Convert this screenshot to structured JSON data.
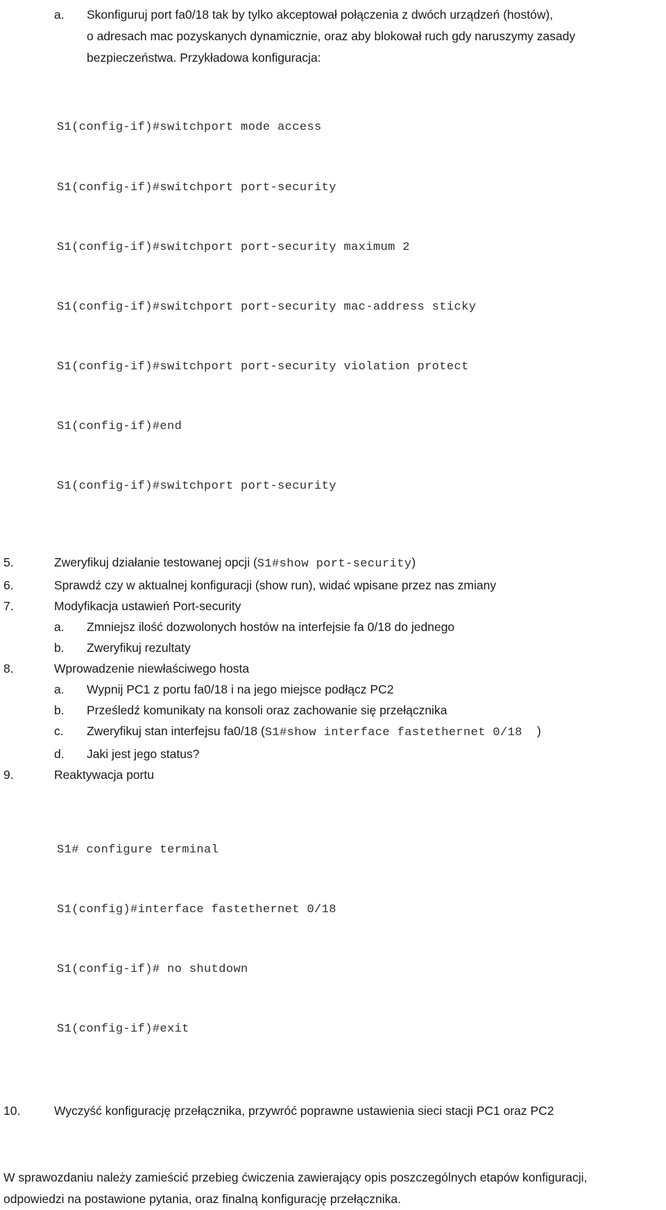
{
  "document": {
    "language": "pl",
    "colors": {
      "background": "#ffffff",
      "body_text": "#1a1a1a",
      "code_text": "#2e2e2e"
    },
    "item_a": {
      "marker": "a.",
      "line1": "Skonfiguruj port fa0/18 tak by tylko akceptował połączenia z dwóch urządzeń (hostów),",
      "line2": "o adresach mac pozyskanych dynamicznie, oraz aby blokował ruch gdy naruszymy zasady",
      "line3": "bezpieczeństwa. Przykładowa konfiguracja:"
    },
    "code_block_1": {
      "lines": [
        "S1(config-if)#switchport mode access",
        "S1(config-if)#switchport port-security",
        "S1(config-if)#switchport port-security maximum 2",
        "S1(config-if)#switchport port-security mac-address sticky",
        "S1(config-if)#switchport port-security violation protect",
        "S1(config-if)#end",
        "S1(config-if)#switchport port-security"
      ]
    },
    "steps": [
      {
        "marker": "5.",
        "text_before": "Zweryfikuj działanie testowanej opcji (",
        "code": "S1#show port-security",
        "text_after": ")"
      },
      {
        "marker": "6.",
        "text_before": "Sprawdź czy w aktualnej konfiguracji (show run), widać wpisane przez nas zmiany",
        "code": "",
        "text_after": ""
      },
      {
        "marker": "7.",
        "text_before": "Modyfikacja ustawień Port-security",
        "code": "",
        "text_after": ""
      }
    ],
    "step7_sub": [
      {
        "marker": "a.",
        "text_before": "Zmniejsz ilość dozwolonych hostów na interfejsie fa 0/18 do jednego",
        "code": "",
        "text_after": ""
      },
      {
        "marker": "b.",
        "text_before": "Zweryfikuj rezultaty",
        "code": "",
        "text_after": ""
      }
    ],
    "step8": {
      "marker": "8.",
      "text": "Wprowadzenie niewłaściwego hosta"
    },
    "step8_sub": [
      {
        "marker": "a.",
        "text_before": "Wypnij PC1 z portu fa0/18 i na jego miejsce podłącz PC2",
        "code": "",
        "text_after": ""
      },
      {
        "marker": "b.",
        "text_before": "Prześledź komunikaty na konsoli oraz zachowanie się przełącznika",
        "code": "",
        "text_after": ""
      },
      {
        "marker": "c.",
        "text_before": "Zweryfikuj stan interfejsu fa0/18 (",
        "code": "S1#show interface fastethernet 0/18  ",
        "text_after": ")"
      },
      {
        "marker": "d.",
        "text_before": "Jaki jest jego status?",
        "code": "",
        "text_after": ""
      }
    ],
    "step9": {
      "marker": "9.",
      "text": "Reaktywacja portu"
    },
    "code_block_2": {
      "lines": [
        "S1# configure terminal",
        "S1(config)#interface fastethernet 0/18",
        "S1(config-if)# no shutdown",
        "S1(config-if)#exit"
      ]
    },
    "step10": {
      "marker": "10.",
      "text": "Wyczyść konfigurację przełącznika, przywróć poprawne ustawienia sieci stacji PC1 oraz PC2"
    },
    "closing": {
      "line1": "W sprawozdaniu należy zamieścić przebieg ćwiczenia zawierający opis poszczególnych etapów konfiguracji,",
      "line2": "odpowiedzi na postawione pytania, oraz finalną konfigurację przełącznika."
    }
  }
}
